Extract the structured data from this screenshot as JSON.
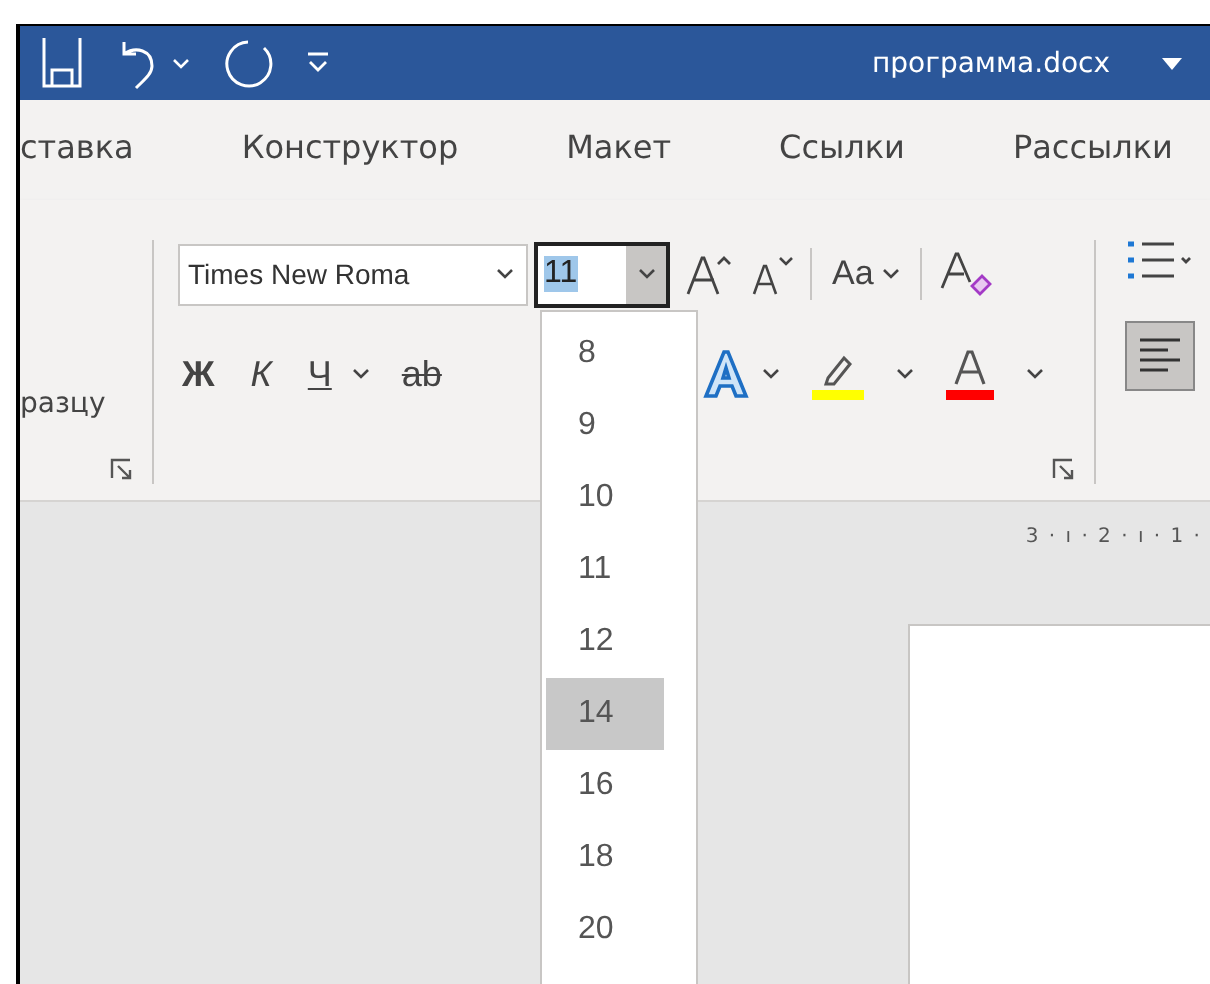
{
  "title_bar": {
    "file_name": "программа.docx"
  },
  "tabs": [
    {
      "label": "ставка",
      "selected": false
    },
    {
      "label": "Конструктор",
      "selected": false
    },
    {
      "label": "Макет",
      "selected": false
    },
    {
      "label": "Ссылки",
      "selected": false
    },
    {
      "label": "Рассылки",
      "selected": false
    }
  ],
  "ribbon": {
    "styles_group_label": "разцу",
    "font_name": "Times New Roma",
    "font_size": "11",
    "bold": "Ж",
    "italic": "К",
    "underline": "Ч",
    "strikethrough": "ab",
    "change_case": "Aa",
    "color_buttons": [
      {
        "kind": "highlight",
        "color": "#ffff00"
      },
      {
        "kind": "font_color",
        "color": "#ff0000"
      }
    ]
  },
  "font_size_menu": [
    {
      "label": "8",
      "selected": false
    },
    {
      "label": "9",
      "selected": false
    },
    {
      "label": "10",
      "selected": false
    },
    {
      "label": "11",
      "selected": false
    },
    {
      "label": "12",
      "selected": false
    },
    {
      "label": "14",
      "selected": true
    },
    {
      "label": "16",
      "selected": false
    },
    {
      "label": "18",
      "selected": false
    },
    {
      "label": "20",
      "selected": false
    }
  ],
  "ruler": "3 · ı · 2 · ı · 1 ·"
}
